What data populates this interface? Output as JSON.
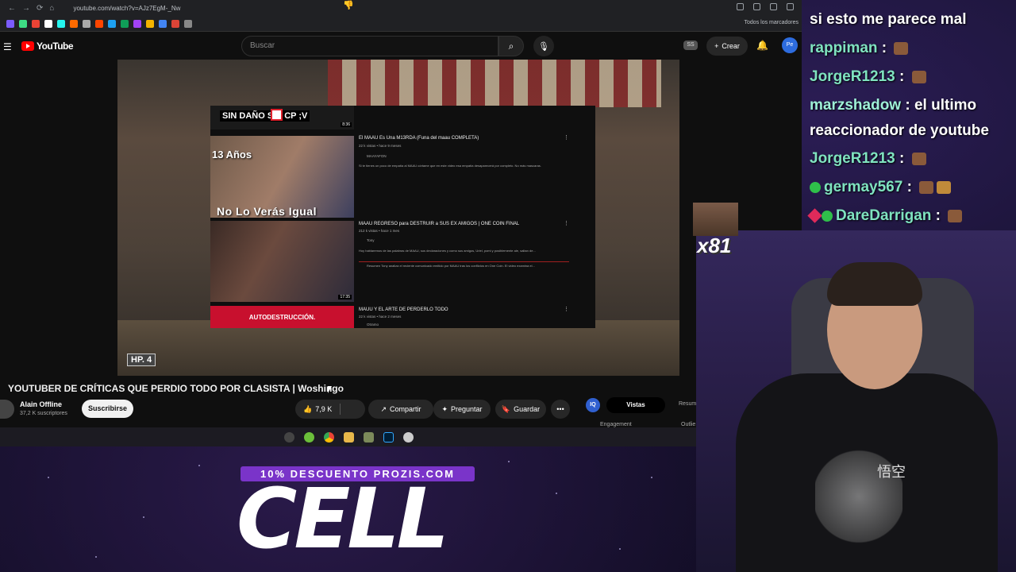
{
  "browser": {
    "url": "youtube.com/watch?v=AJz7EgM-_Nw",
    "bookmarks_all": "Todos los marcadores"
  },
  "youtube": {
    "logo_text": "YouTube",
    "search_placeholder": "Buscar",
    "ss_badge": "SS",
    "create_label": "Crear",
    "avatar_text": "Pe"
  },
  "video": {
    "title": "YOUTUBER DE CRÍTICAS QUE PERDIO TODO POR CLASISTA | Woshingo",
    "hp_label": "HP. 4",
    "channel_name": "Alain Offline",
    "channel_subs": "37,2 K suscriptores",
    "subscribe_label": "Suscribirse",
    "like_count": "7,9 K",
    "share_label": "Compartir",
    "ask_label": "Preguntar",
    "save_label": "Guardar",
    "iq_label": "IQ",
    "tab_views": "Vistas",
    "tab_summary": "Resum",
    "engagement_label": "Engagement",
    "outlier_label": "Outlie"
  },
  "inner_results": [
    {
      "thumb_text": "SIN DAÑO SIN CP ;V",
      "duration": "8:36",
      "title": "El MAAU Es Una M13RDA (Funa del maau COMPLETA)",
      "meta": "22 k vistas • hace 9 meses",
      "channel": "MAAYAFON",
      "desc": "Si te tienes un poco de empatía al MAAU córtame que en este video esa empatía desaparecerá por completo. No más mascaras."
    },
    {
      "thumb_text_top": "13 Años",
      "thumb_text_bottom": "No Lo Verás Igual",
      "duration": "17:35",
      "title": "MAAU REGRESO para DESTRUIR a SUS EX AMIGOS | ONE COIN FINAL",
      "meta": "212 k vistas • hace 1 mes",
      "channel": "Tony",
      "desc": "Hoy hablaremos de las palabras de MAAU, sus declaraciones y como sus amigos, Uriel, pomi y posiblemente ale, saltan de...",
      "summary": "Resumen  Tony analiza el reciente comunicado emitido por MAAU tras los conflictos en One Coin. El video examina el..."
    },
    {
      "thumb_text": "AUTODESTRUCCIÓN.",
      "title": "MAUU Y EL ARTE DE PERDERLO TODO",
      "meta": "22 k vistas • hace 2 meses",
      "channel": "Otramo"
    }
  ],
  "chat": [
    {
      "user": "",
      "message": "si esto me parece mal"
    },
    {
      "user": "rappiman",
      "message": ""
    },
    {
      "user": "JorgeR1213",
      "message": ""
    },
    {
      "user": "marzshadow",
      "message": "el ultimo"
    },
    {
      "user": "",
      "message": "reaccionador de youtube"
    },
    {
      "user": "JorgeR1213",
      "message": ""
    },
    {
      "user": "germay567",
      "message": ""
    },
    {
      "user": "DareDarrigan",
      "message": ""
    }
  ],
  "overlay": {
    "emote_count": "x81",
    "promo": "10% DESCUENTO PROZIS.COM",
    "brand": "CELL",
    "shirt_kanji": "悟空"
  },
  "colors": {
    "youtube_red": "#ff0000",
    "chat_username": "#7fe3c0",
    "promo_purple": "#7a34c9"
  }
}
